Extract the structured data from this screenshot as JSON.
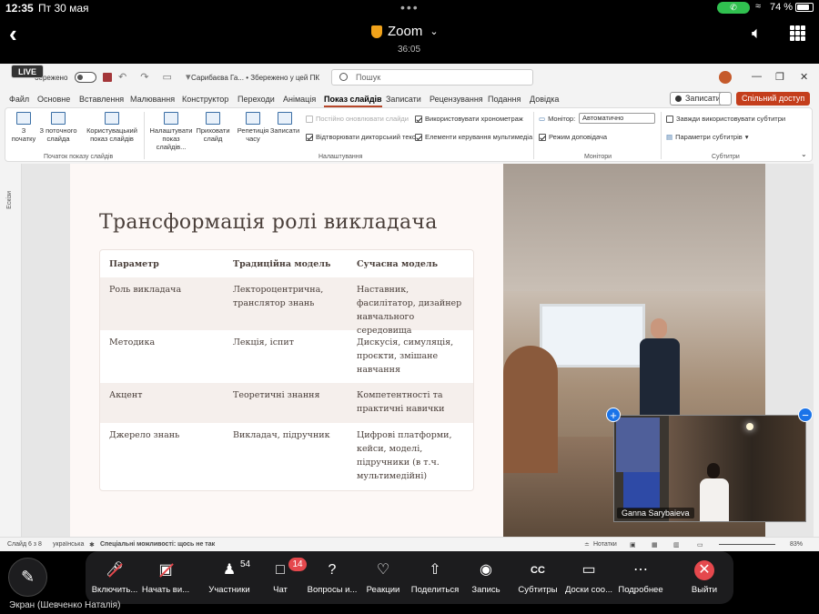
{
  "status_bar": {
    "time": "12:35",
    "date": "Пт 30 мая",
    "battery": "74 %"
  },
  "zoom_header": {
    "title": "Zoom",
    "timer": "36:05",
    "live_badge": "LIVE"
  },
  "ppt": {
    "saved_label": "бережено",
    "doc_name": "Сарибаєва Га... • Збережено у цей ПК",
    "search_placeholder": "Пошук",
    "tabs": [
      "Файл",
      "Основне",
      "Вставлення",
      "Малювання",
      "Конструктор",
      "Переходи",
      "Анімація",
      "Показ слайдів",
      "Записати",
      "Рецензування",
      "Подання",
      "Довідка"
    ],
    "active_tab": "Показ слайдів",
    "record_button": "Записати",
    "share_button": "Спільний доступ",
    "ribbon": {
      "from_start": "З початку",
      "from_current": "З поточного слайда",
      "custom_show": "Користувацький показ слайдів",
      "group_start": "Початок показу слайдів",
      "setup_show": "Налаштувати показ слайдів...",
      "hide_slide": "Приховати слайд",
      "rehearse": "Репетиція часу",
      "record": "Записати",
      "keep_updated": "Постійно оновлювати слайди",
      "play_narration": "Відтворювати дикторський текст",
      "use_timings": "Використовувати хронометраж",
      "media_controls": "Елементи керування мультимедіа",
      "group_setup": "Налаштування",
      "monitor_label": "Монітор:",
      "monitor_value": "Автоматично",
      "presenter_view": "Режим доповідача",
      "group_monitors": "Монітори",
      "always_subtitles": "Завжди використовувати субтитри",
      "subtitle_settings": "Параметри субтитрів",
      "group_subtitles": "Субтитри"
    },
    "left_pane_label": "Ескізи",
    "slide": {
      "title": "Трансформація ролі викладача",
      "headers": [
        "Параметр",
        "Традиційна модель",
        "Сучасна модель"
      ],
      "rows": [
        [
          "Роль викладача",
          "Лектороцентрична, транслятор знань",
          "Наставник, фасилітатор, дизайнер навчального середовища"
        ],
        [
          "Методика",
          "Лекція, іспит",
          "Дискусія, симуляція, проєкти, змішане навчання"
        ],
        [
          "Акцент",
          "Теоретичні знання",
          "Компетентності та практичні навички"
        ],
        [
          "Джерело знань",
          "Викладач, підручник",
          "Цифрові платформи, кейси, моделі, підручники (в т.ч. мультимедійні)"
        ]
      ]
    },
    "status": {
      "slide_counter": "Слайд 6 з 8",
      "language": "українська",
      "accessibility": "Спеціальні можливості: щось не так",
      "notes": "Нотатки",
      "zoom": "83%"
    }
  },
  "video_tile": {
    "name": "Ganna Sarybaieva"
  },
  "toolbar": {
    "participants_count": "54",
    "chat_badge": "14",
    "items": [
      {
        "label": "Включить...",
        "icon": "mic-muted-icon"
      },
      {
        "label": "Начать ви...",
        "icon": "video-muted-icon"
      },
      {
        "label": "Участники",
        "icon": "participants-icon"
      },
      {
        "label": "Чат",
        "icon": "chat-icon"
      },
      {
        "label": "Вопросы и...",
        "icon": "qa-icon"
      },
      {
        "label": "Реакции",
        "icon": "heart-icon"
      },
      {
        "label": "Поделиться",
        "icon": "share-icon"
      },
      {
        "label": "Запись",
        "icon": "record-icon"
      },
      {
        "label": "Субтитры",
        "icon": "cc-icon"
      },
      {
        "label": "Доски соо...",
        "icon": "whiteboard-icon"
      },
      {
        "label": "Подробнее",
        "icon": "more-icon"
      },
      {
        "label": "Выйти",
        "icon": "leave-icon"
      }
    ]
  },
  "screen_share_label": "Экран (Шевченко Наталія)"
}
